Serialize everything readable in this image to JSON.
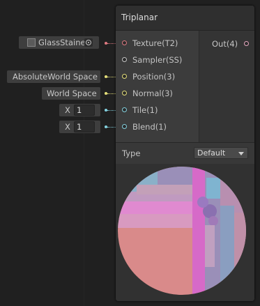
{
  "node": {
    "title": "Triplanar",
    "inputs": [
      {
        "label": "Texture(T2)",
        "color": "#e07a82"
      },
      {
        "label": "Sampler(SS)",
        "color": "#c8c8c8"
      },
      {
        "label": "Position(3)",
        "color": "#e6e07a"
      },
      {
        "label": "Normal(3)",
        "color": "#e6e07a"
      },
      {
        "label": "Tile(1)",
        "color": "#84d2e0"
      },
      {
        "label": "Blend(1)",
        "color": "#84d2e0"
      }
    ],
    "output": {
      "label": "Out(4)",
      "color": "#e6a8c0"
    },
    "settings": {
      "type_label": "Type",
      "type_value": "Default"
    }
  },
  "external_inputs": {
    "texture": {
      "value": "GlassStaine"
    },
    "position": {
      "value": "AbsoluteWorld Space"
    },
    "normal": {
      "value": "World Space"
    },
    "tile": {
      "axis": "X",
      "value": "1"
    },
    "blend": {
      "axis": "X",
      "value": "1"
    }
  },
  "icons": [
    "texture-thumbnail-icon",
    "object-picker-icon",
    "dropdown-arrow-icon"
  ]
}
